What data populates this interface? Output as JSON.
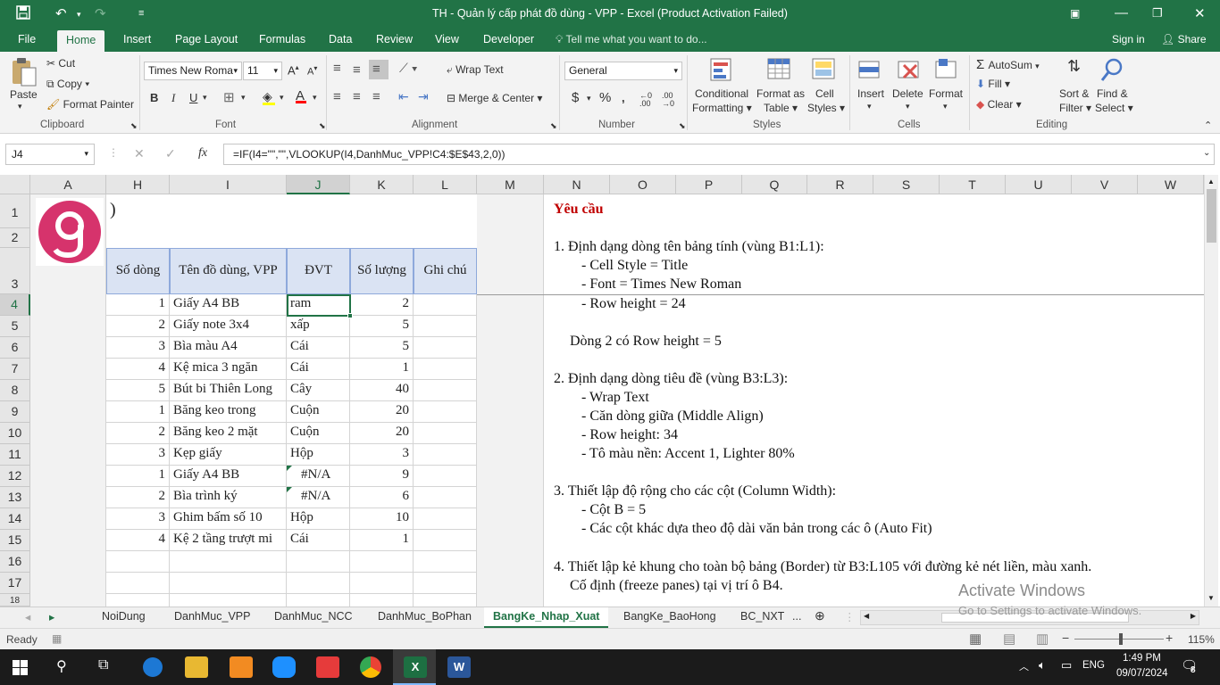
{
  "window": {
    "title": "TH - Quản lý cấp phát đồ dùng - VPP - Excel (Product Activation Failed)"
  },
  "ribbon_tabs": [
    "File",
    "Home",
    "Insert",
    "Page Layout",
    "Formulas",
    "Data",
    "Review",
    "View",
    "Developer"
  ],
  "tell_me": "Tell me what you want to do...",
  "sign_in": "Sign in",
  "share": "Share",
  "clipboard": {
    "paste": "Paste",
    "cut": "Cut",
    "copy": "Copy",
    "format_painter": "Format Painter",
    "label": "Clipboard"
  },
  "font": {
    "name": "Times New Roma",
    "size": "11",
    "label": "Font",
    "bold": "B",
    "italic": "I",
    "underline": "U"
  },
  "alignment": {
    "wrap": "Wrap Text",
    "merge": "Merge & Center",
    "label": "Alignment"
  },
  "number": {
    "format": "General",
    "label": "Number",
    "currency": "$",
    "percent": "%"
  },
  "styles": {
    "cond1": "Conditional",
    "cond2": "Formatting",
    "fmt1": "Format as",
    "fmt2": "Table",
    "cell1": "Cell",
    "cell2": "Styles",
    "label": "Styles"
  },
  "cells": {
    "insert": "Insert",
    "delete": "Delete",
    "format": "Format",
    "label": "Cells"
  },
  "editing": {
    "autosum": "AutoSum",
    "fill": "Fill",
    "clear": "Clear",
    "sort1": "Sort &",
    "sort2": "Filter",
    "find1": "Find &",
    "find2": "Select",
    "label": "Editing"
  },
  "formula_bar": {
    "name_box": "J4",
    "fx": "fx",
    "formula": "=IF(I4=\"\",\"\",VLOOKUP(I4,DanhMuc_VPP!C4:$E$43,2,0))"
  },
  "columns": [
    "A",
    "H",
    "I",
    "J",
    "K",
    "L",
    "M",
    "N",
    "O",
    "P",
    "Q",
    "R",
    "S",
    "T",
    "U",
    "V",
    "W"
  ],
  "rows": [
    "1",
    "2",
    "3",
    "4",
    "5",
    "6",
    "7",
    "8",
    "9",
    "10",
    "11",
    "12",
    "13",
    "14",
    "15",
    "16",
    "17",
    "18"
  ],
  "cell_b1": ")",
  "table_headers": [
    "Số dòng",
    "Tên đồ dùng, VPP",
    "ĐVT",
    "Số lượng",
    "Ghi chú"
  ],
  "table_rows": [
    [
      "1",
      "Giấy A4 BB",
      "ram",
      "2"
    ],
    [
      "2",
      "Giấy note 3x4",
      "xấp",
      "5"
    ],
    [
      "3",
      "Bìa màu A4",
      "Cái",
      "5"
    ],
    [
      "4",
      "Kệ mica 3 ngăn",
      "Cái",
      "1"
    ],
    [
      "5",
      "Bút bi Thiên Long",
      "Cây",
      "40"
    ],
    [
      "1",
      "Băng keo trong",
      "Cuộn",
      "20"
    ],
    [
      "2",
      "Băng keo 2 mặt",
      "Cuộn",
      "20"
    ],
    [
      "3",
      "Kẹp giấy",
      "Hộp",
      "3"
    ],
    [
      "1",
      "Giấy A4 BB",
      "#N/A",
      "9"
    ],
    [
      "2",
      "Bìa trình ký",
      "#N/A",
      "6"
    ],
    [
      "3",
      "Ghim bấm số 10",
      "Hộp",
      "10"
    ],
    [
      "4",
      "Kệ 2 tầng trượt mi",
      "Cái",
      "1"
    ]
  ],
  "requirements": {
    "title": "Yêu cầu",
    "lines": [
      "1. Định dạng dòng tên bảng tính (vùng B1:L1):",
      "- Cell Style = Title",
      "- Font = Times New Roman",
      "- Row height = 24",
      "Dòng 2 có Row height = 5",
      "2. Định dạng dòng tiêu đề (vùng B3:L3):",
      "- Wrap Text",
      "- Căn dòng giữa (Middle Align)",
      "- Row height: 34",
      "- Tô màu nền: Accent 1, Lighter 80%",
      "3. Thiết lập độ rộng cho các cột (Column Width):",
      "- Cột B = 5",
      "- Các cột khác dựa theo độ dài văn bản trong các ô (Auto Fit)",
      "4. Thiết lập kẻ khung cho toàn bộ bảng (Border) từ B3:L105 với đường kẻ nét liền, màu xanh.",
      "Cố định (freeze panes) tại vị trí ô B4."
    ]
  },
  "sheet_tabs": [
    "NoiDung",
    "DanhMuc_VPP",
    "DanhMuc_NCC",
    "DanhMuc_BoPhan",
    "BangKe_Nhap_Xuat",
    "BangKe_BaoHong",
    "BC_NXT",
    "..."
  ],
  "active_sheet": "BangKe_Nhap_Xuat",
  "watermark": {
    "line1": "Activate Windows",
    "line2": "Go to Settings to activate Windows."
  },
  "status": {
    "ready": "Ready",
    "zoom": "115%"
  },
  "taskbar": {
    "lang": "ENG",
    "time": "1:49 PM",
    "date": "09/07/2024",
    "notif": "8"
  },
  "colors": {
    "excel_green": "#217346",
    "header_fill": "#dae3f3",
    "title_red": "#c00000"
  }
}
